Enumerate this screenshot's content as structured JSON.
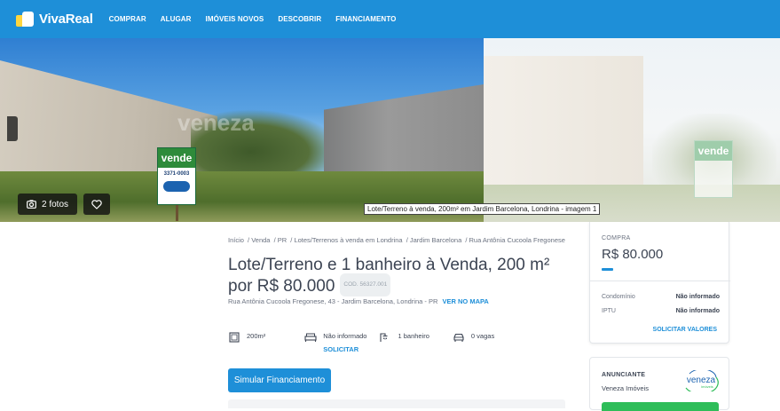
{
  "header": {
    "brand": "VivaReal",
    "nav": [
      "COMPRAR",
      "ALUGAR",
      "IMÓVEIS NOVOS",
      "DESCOBRIR",
      "FINANCIAMENTO"
    ]
  },
  "gallery": {
    "photos_button": "2 fotos",
    "tooltip": "Lote/Terreno à venda, 200m² em Jardim Barcelona, Londrina - imagem 1",
    "sign_text": "vende",
    "sign_number": "3371-0003",
    "watermark": "veneza"
  },
  "breadcrumb": [
    "Início",
    "Venda",
    "PR",
    "Lotes/Terrenos à venda em Londrina",
    "Jardim Barcelona",
    "Rua Antônia Cucoola Fregonese"
  ],
  "listing": {
    "title": "Lote/Terreno e 1 banheiro à Venda, 200 m² por R$ 80.000",
    "code": "COD. 56327.001",
    "address": "Rua Antônia Cucoola Fregonese, 43 - Jardim Barcelona, Londrina - PR",
    "map_link": "VER NO MAPA",
    "features": {
      "area": "200m²",
      "bedrooms": "Não informado",
      "bedrooms_action": "SOLICITAR",
      "bathrooms": "1 banheiro",
      "parking": "0 vagas"
    },
    "simulate_button": "Simular Financiamento"
  },
  "price_card": {
    "label": "COMPRA",
    "price": "R$ 80.000",
    "condo_label": "Condomínio",
    "condo_value": "Não informado",
    "iptu_label": "IPTU",
    "iptu_value": "Não informado",
    "request_values": "SOLICITAR VALORES"
  },
  "advertiser": {
    "label": "ANUNCIANTE",
    "name": "Veneza Imóveis",
    "logo_text": "veneza",
    "logo_sub": "imóveis"
  },
  "colors": {
    "header": "#1e8fd8",
    "accent": "#1e8fd8",
    "brand_yellow": "#ffd63f",
    "contact_green": "#2ebd59"
  }
}
